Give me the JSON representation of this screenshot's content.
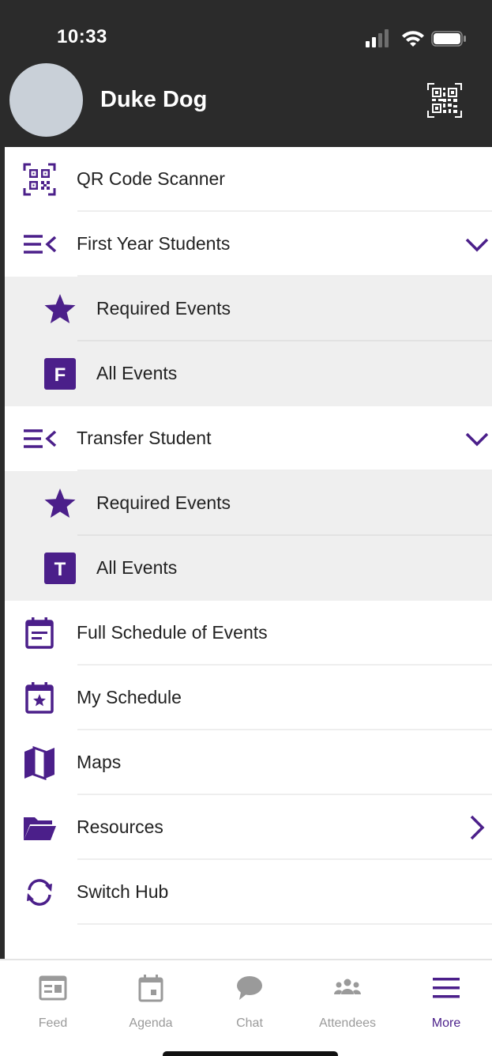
{
  "status_bar": {
    "time": "10:33"
  },
  "header": {
    "user_name": "Duke Dog"
  },
  "colors": {
    "accent": "#4b1f8a",
    "header_bg": "#2b2b2b",
    "submenu_bg": "#efefef",
    "inactive_tab": "#9a9a9a"
  },
  "menu": {
    "qr_scanner": "QR Code Scanner",
    "first_year": {
      "label": "First Year Students",
      "required": "Required Events",
      "all": "All Events",
      "badge": "F"
    },
    "transfer": {
      "label": "Transfer Student",
      "required": "Required Events",
      "all": "All Events",
      "badge": "T"
    },
    "full_schedule": "Full Schedule of Events",
    "my_schedule": "My Schedule",
    "maps": "Maps",
    "resources": "Resources",
    "switch_hub": "Switch Hub"
  },
  "tabs": {
    "feed": "Feed",
    "agenda": "Agenda",
    "chat": "Chat",
    "attendees": "Attendees",
    "more": "More",
    "active": "More"
  }
}
